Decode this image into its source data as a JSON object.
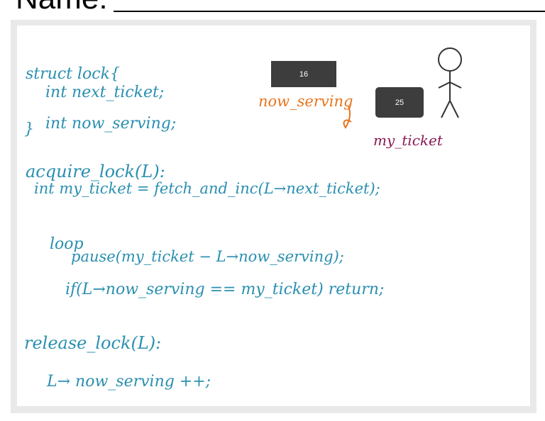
{
  "header": {
    "name_label": "Name:"
  },
  "diagram": {
    "now_serving_value": "16",
    "my_ticket_value": "25",
    "now_serving_label": "now_serving",
    "my_ticket_label": "my_ticket"
  },
  "code": {
    "struct_line": "struct lock{",
    "next_ticket_line": "int next_ticket;",
    "now_serving_line": "int now_serving;",
    "close_brace": "}",
    "acquire_line": "acquire_lock(L):",
    "my_ticket_line": "int my_ticket = fetch_and_inc(L→next_ticket);",
    "loop_line": "loop",
    "pause_line": "pause(my_ticket − L→now_serving);",
    "if_line": "if(L→now_serving == my_ticket) return;",
    "release_line": "release_lock(L):",
    "increment_line": "L→ now_serving ++;"
  },
  "colors": {
    "code_ink": "#2a8fb0",
    "now_serving_ink": "#e8741f",
    "my_ticket_ink": "#8b1a55",
    "box_fill": "#3d3d3d"
  }
}
